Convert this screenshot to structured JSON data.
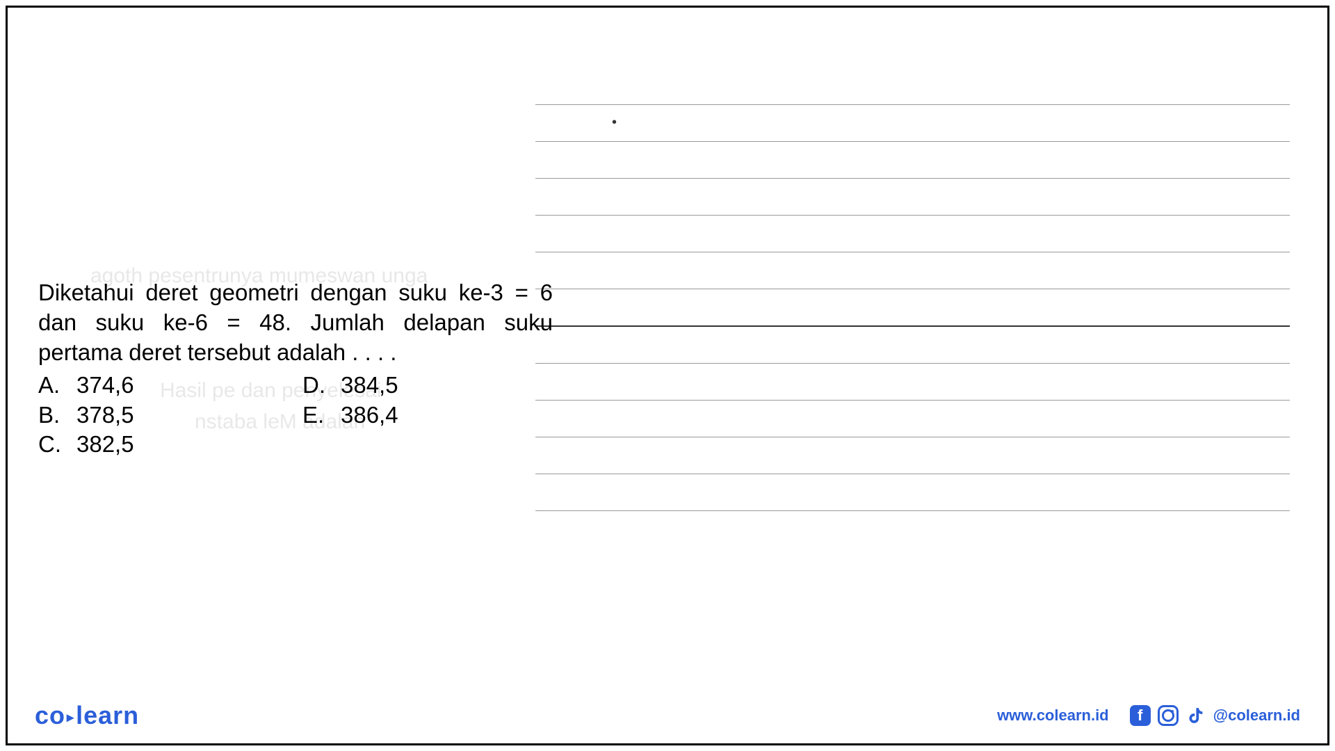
{
  "question": {
    "text": "Diketahui deret geometri dengan suku ke-3 = 6 dan suku ke-6 = 48. Jumlah delapan suku pertama deret tersebut adalah . . . .",
    "options": {
      "A": "374,6",
      "B": "378,5",
      "C": "382,5",
      "D": "384,5",
      "E": "386,4"
    }
  },
  "ghost": {
    "line1": "agoth pesentrunya mumeswan unga",
    "line2": "Hasil pe          dan penyelesai",
    "line3": "nstaba leM        adalah"
  },
  "logo": {
    "co": "co",
    "arrow": "▸",
    "learn": "learn"
  },
  "footer": {
    "url": "www.colearn.id",
    "handle": "@colearn.id"
  },
  "labels": {
    "A": "A.",
    "B": "B.",
    "C": "C.",
    "D": "D.",
    "E": "E."
  }
}
